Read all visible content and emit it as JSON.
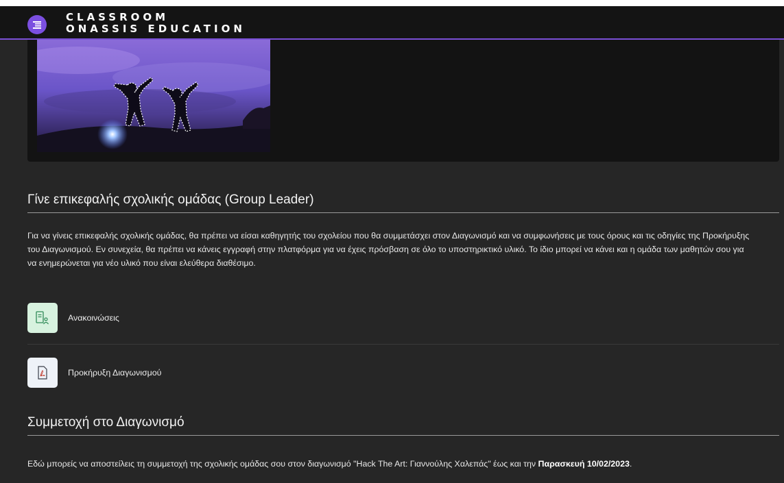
{
  "header": {
    "brand_line1": "CLASSROOM",
    "brand_line2": "ONASSIS EDUCATION",
    "menu_icon": "menu-list-icon",
    "accent_color": "#7b4fe0"
  },
  "sections": [
    {
      "title": "Γίνε επικεφαλής σχολικής ομάδας (Group Leader)",
      "text": "Για να γίνεις επικεφαλής σχολικής ομάδας, θα πρέπει να είσαι καθηγητής του σχολείου που θα συμμετάσχει στον Διαγωνισμό και να συμφωνήσεις με τους όρους και τις οδηγίες της Προκήρυξης του Διαγωνισμού. Εν συνεχεία, θα πρέπει να κάνεις εγγραφή στην πλατφόρμα για να έχεις πρόσβαση σε όλο το υποστηρικτικό υλικό. Το ίδιο μπορεί να κάνει και η ομάδα των μαθητών σου για να ενημερώνεται για νέο υλικό που είναι ελεύθερα διαθέσιμο."
    },
    {
      "title": "Συμμετοχή στο Διαγωνισμό",
      "text_before": "Εδώ μπορείς να αποστείλεις τη συμμετοχή της σχολικής ομάδας σου στον διαγωνισμό \"Hack The Art: Γιαννούλης Χαλεπάς\" έως και την ",
      "text_bold": "Παρασκευή 10/02/2023",
      "text_after": "."
    }
  ],
  "activities": [
    {
      "label": "Ανακοινώσεις",
      "icon": "announcements-forum-icon",
      "icon_bg": "#d7f2df"
    },
    {
      "label": "Προκήρυξη Διαγωνισμού",
      "icon": "pdf-file-icon",
      "icon_bg": "#eef2f8"
    }
  ]
}
